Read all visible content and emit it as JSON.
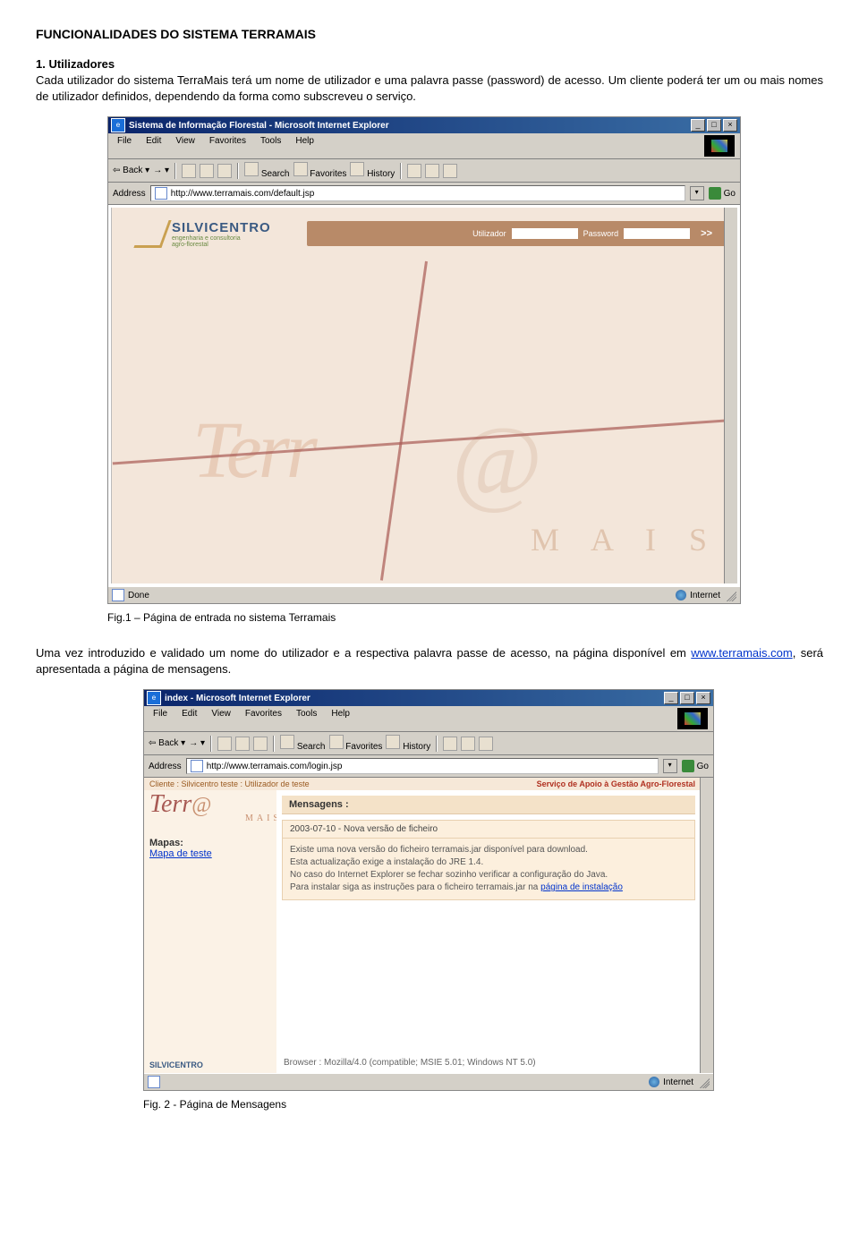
{
  "doc": {
    "title": "FUNCIONALIDADES DO SISTEMA TERRAMAIS",
    "section1_heading": "1. Utilizadores",
    "intro_para": "Cada utilizador do sistema TerraMais terá um nome de utilizador e uma palavra passe (password) de acesso. Um cliente poderá ter um ou mais nomes de utilizador definidos, dependendo da forma como subscreveu o serviço.",
    "fig1_caption": "Fig.1 – Página de entrada no sistema Terramais",
    "para2_a": "Uma vez introduzido e validado um nome do utilizador e a respectiva palavra passe de acesso, na página disponível em ",
    "para2_link": "www.terramais.com",
    "para2_b": ", será apresentada a página de mensagens.",
    "fig2_caption": "Fig. 2 - Página de Mensagens"
  },
  "ie": {
    "title1": "Sistema de Informação Florestal - Microsoft Internet Explorer",
    "title2": "index - Microsoft Internet Explorer",
    "menu": {
      "file": "File",
      "edit": "Edit",
      "view": "View",
      "favorites": "Favorites",
      "tools": "Tools",
      "help": "Help"
    },
    "toolbar": {
      "back": "Back",
      "search": "Search",
      "favorites": "Favorites",
      "history": "History"
    },
    "addr_label": "Address",
    "addr1": "http://www.terramais.com/default.jsp",
    "addr2": "http://www.terramais.com/login.jsp",
    "go": "Go",
    "status_done": "Done",
    "status_internet": "Internet"
  },
  "login": {
    "brand": "SILVICENTRO",
    "brand_sub1": "engenharia e consultoria",
    "brand_sub2": "agro-florestal",
    "user_label": "Utilizador",
    "pass_label": "Password",
    "go": ">>",
    "wm_terr": "Terr",
    "wm_at": "@",
    "wm_mais": "M A I S"
  },
  "msgs": {
    "client_line": "Cliente : Silvicentro teste : Utilizador de teste",
    "service_line": "Serviço de Apoio à Gestão Agro-Florestal",
    "logo_terr": "Terr",
    "logo_at": "@",
    "logo_mais": "MAIS",
    "mapas_label": "Mapas:",
    "mapa_link": "Mapa de teste",
    "silvi_small": "SILVICENTRO",
    "panel_header": "Mensagens :",
    "msg_title": "2003-07-10 - Nova versão de ficheiro",
    "msg_body_1": "Existe uma nova versão do ficheiro terramais.jar disponível para download.",
    "msg_body_2": "Esta actualização exige a instalação do JRE 1.4.",
    "msg_body_3": "No caso do Internet Explorer se fechar sozinho verificar a configuração do Java.",
    "msg_body_4a": "Para instalar siga as instruções para o ficheiro terramais.jar na ",
    "msg_body_4_link": "página de instalação",
    "browser_line": "Browser : Mozilla/4.0 (compatible; MSIE 5.01; Windows NT 5.0)"
  }
}
